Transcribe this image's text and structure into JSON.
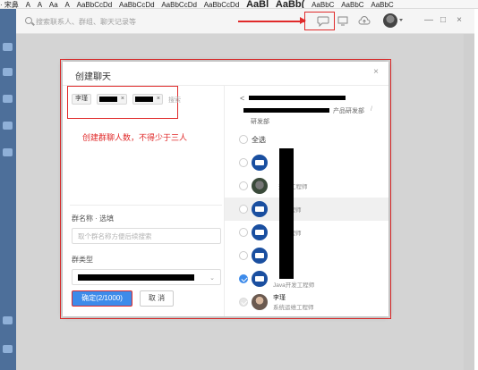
{
  "ribbon": {
    "items": [
      "· 宋鼻",
      "A",
      "A",
      "Aa",
      "A",
      "AaBbCcDd",
      "AaBbCcDd",
      "AaBbCcDd",
      "AaBbCcDd",
      "AaBl",
      "AaBb(",
      "AaBbC",
      "AaBbC",
      "AaBbC"
    ]
  },
  "search": {
    "placeholder": "搜索联系人、群组、聊天记录等"
  },
  "window_buttons": {
    "minimize": "—",
    "maximize": "□",
    "close": "×"
  },
  "dialog": {
    "title": "创建聊天",
    "close": "×",
    "chips": [
      {
        "label": "李瑾",
        "removable": false
      },
      {
        "label": "",
        "removable": true
      },
      {
        "label": "",
        "removable": true
      }
    ],
    "chip_remove": "×",
    "chip_search_placeholder": "搜索",
    "note": "创建群聊人数，不得少于三人",
    "group_name_label": "群名称 · 选填",
    "group_name_placeholder": "取个群名称方便后续搜索",
    "group_type_label": "群类型",
    "group_type_caret": "⌄",
    "ok_label": "确定(2/1000)",
    "cancel_label": "取 消",
    "back": "<",
    "breadcrumb_product": "产品研发部",
    "breadcrumb_sep": "/",
    "breadcrumb_dept": "研发部",
    "select_all": "全选",
    "members": [
      {
        "sub": "",
        "state": "unchecked",
        "avatar": "logo",
        "highlight": false
      },
      {
        "sub": "开发工程师",
        "state": "unchecked",
        "avatar": "photo",
        "highlight": false
      },
      {
        "sub": "工程师",
        "state": "unchecked",
        "avatar": "logo",
        "highlight": true
      },
      {
        "sub": "工程师",
        "state": "unchecked",
        "avatar": "logo",
        "highlight": false
      },
      {
        "sub": "",
        "state": "unchecked",
        "avatar": "logo",
        "highlight": false
      },
      {
        "sub": "Java开发工程师",
        "state": "checked",
        "avatar": "logo",
        "highlight": false
      },
      {
        "name": "李瑾",
        "sub": "系统运维工程师",
        "state": "disabled",
        "avatar": "person",
        "highlight": false
      }
    ]
  },
  "colors": {
    "accent": "#3d8bea",
    "annotation": "#e02a2a"
  }
}
